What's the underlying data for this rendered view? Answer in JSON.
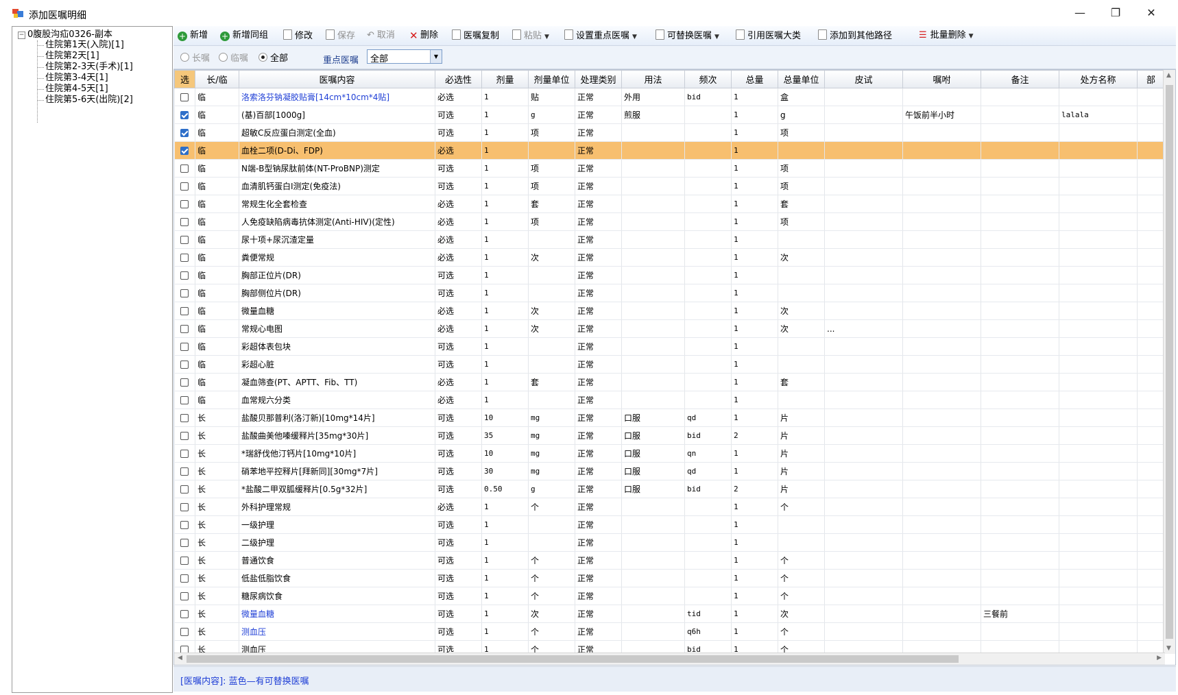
{
  "window": {
    "title": "添加医嘱明细",
    "minimize_icon": "minimize-icon",
    "maximize_icon": "maximize-icon",
    "close_icon": "close-icon"
  },
  "tree": {
    "root": "0腹股沟疝0326-副本",
    "items": [
      "住院第1天(入院)[1]",
      "住院第2天[1]",
      "住院第2-3天(手术)[1]",
      "住院第3-4天[1]",
      "住院第4-5天[1]",
      "住院第5-6天(出院)[2]"
    ]
  },
  "toolbar": {
    "add": "新增",
    "add_group": "新增同组",
    "edit": "修改",
    "save": "保存",
    "cancel": "取消",
    "delete": "删除",
    "copy": "医嘱复制",
    "paste": "粘贴",
    "set_focus": "设置重点医嘱",
    "replaceable": "可替换医嘱",
    "reference": "引用医嘱大类",
    "add_other": "添加到其他路径",
    "batch_delete": "批量删除"
  },
  "filter": {
    "long_term": "长嘱",
    "temporary": "临嘱",
    "all": "全部",
    "selected": "全部",
    "focus_label": "重点医嘱",
    "focus_value": "全部"
  },
  "grid": {
    "columns": [
      "选",
      "长/临",
      "医嘱内容",
      "必选性",
      "剂量",
      "剂量单位",
      "处理类别",
      "用法",
      "频次",
      "总量",
      "总量单位",
      "皮试",
      "嘱咐",
      "备注",
      "处方名称",
      "部"
    ],
    "rows": [
      {
        "checked": false,
        "type": "临",
        "content": "洛索洛芬钠凝胶贴膏[14cm*10cm*4贴]",
        "required": "必选",
        "dose": "1",
        "dose_unit": "贴",
        "category": "正常",
        "usage": "外用",
        "freq": "bid",
        "total": "1",
        "total_unit": "盒",
        "skin_test": "",
        "instruction": "",
        "remark": "",
        "rx_name": "",
        "blue": true,
        "highlight": false
      },
      {
        "checked": true,
        "type": "临",
        "content": "(基)百部[1000g]",
        "required": "可选",
        "dose": "1",
        "dose_unit": "g",
        "category": "正常",
        "usage": "煎服",
        "freq": "",
        "total": "1",
        "total_unit": "g",
        "skin_test": "",
        "instruction": "午饭前半小时",
        "remark": "",
        "rx_name": "lalala",
        "blue": false,
        "highlight": false
      },
      {
        "checked": true,
        "type": "临",
        "content": "超敏C反应蛋白测定(全血)",
        "required": "可选",
        "dose": "1",
        "dose_unit": "项",
        "category": "正常",
        "usage": "",
        "freq": "",
        "total": "1",
        "total_unit": "项",
        "skin_test": "",
        "instruction": "",
        "remark": "",
        "rx_name": "",
        "blue": false,
        "highlight": false
      },
      {
        "checked": true,
        "type": "临",
        "content": "血栓二项(D-Di、FDP)",
        "required": "必选",
        "dose": "1",
        "dose_unit": "",
        "category": "正常",
        "usage": "",
        "freq": "",
        "total": "1",
        "total_unit": "",
        "skin_test": "",
        "instruction": "",
        "remark": "",
        "rx_name": "",
        "blue": false,
        "highlight": true
      },
      {
        "checked": false,
        "type": "临",
        "content": "N端-B型钠尿肽前体(NT-ProBNP)测定",
        "required": "可选",
        "dose": "1",
        "dose_unit": "项",
        "category": "正常",
        "usage": "",
        "freq": "",
        "total": "1",
        "total_unit": "项",
        "skin_test": "",
        "instruction": "",
        "remark": "",
        "rx_name": "",
        "blue": false,
        "highlight": false
      },
      {
        "checked": false,
        "type": "临",
        "content": "血清肌钙蛋白Ⅰ测定(免疫法)",
        "required": "可选",
        "dose": "1",
        "dose_unit": "项",
        "category": "正常",
        "usage": "",
        "freq": "",
        "total": "1",
        "total_unit": "项",
        "skin_test": "",
        "instruction": "",
        "remark": "",
        "rx_name": "",
        "blue": false,
        "highlight": false
      },
      {
        "checked": false,
        "type": "临",
        "content": "常规生化全套检查",
        "required": "必选",
        "dose": "1",
        "dose_unit": "套",
        "category": "正常",
        "usage": "",
        "freq": "",
        "total": "1",
        "total_unit": "套",
        "skin_test": "",
        "instruction": "",
        "remark": "",
        "rx_name": "",
        "blue": false,
        "highlight": false
      },
      {
        "checked": false,
        "type": "临",
        "content": "人免疫缺陷病毒抗体测定(Anti-HIV)(定性)",
        "required": "必选",
        "dose": "1",
        "dose_unit": "项",
        "category": "正常",
        "usage": "",
        "freq": "",
        "total": "1",
        "total_unit": "项",
        "skin_test": "",
        "instruction": "",
        "remark": "",
        "rx_name": "",
        "blue": false,
        "highlight": false
      },
      {
        "checked": false,
        "type": "临",
        "content": "尿十项+尿沉渣定量",
        "required": "必选",
        "dose": "1",
        "dose_unit": "",
        "category": "正常",
        "usage": "",
        "freq": "",
        "total": "1",
        "total_unit": "",
        "skin_test": "",
        "instruction": "",
        "remark": "",
        "rx_name": "",
        "blue": false,
        "highlight": false
      },
      {
        "checked": false,
        "type": "临",
        "content": "粪便常规",
        "required": "必选",
        "dose": "1",
        "dose_unit": "次",
        "category": "正常",
        "usage": "",
        "freq": "",
        "total": "1",
        "total_unit": "次",
        "skin_test": "",
        "instruction": "",
        "remark": "",
        "rx_name": "",
        "blue": false,
        "highlight": false
      },
      {
        "checked": false,
        "type": "临",
        "content": "胸部正位片(DR)",
        "required": "可选",
        "dose": "1",
        "dose_unit": "",
        "category": "正常",
        "usage": "",
        "freq": "",
        "total": "1",
        "total_unit": "",
        "skin_test": "",
        "instruction": "",
        "remark": "",
        "rx_name": "",
        "blue": false,
        "highlight": false
      },
      {
        "checked": false,
        "type": "临",
        "content": "胸部侧位片(DR)",
        "required": "可选",
        "dose": "1",
        "dose_unit": "",
        "category": "正常",
        "usage": "",
        "freq": "",
        "total": "1",
        "total_unit": "",
        "skin_test": "",
        "instruction": "",
        "remark": "",
        "rx_name": "",
        "blue": false,
        "highlight": false
      },
      {
        "checked": false,
        "type": "临",
        "content": "微量血糖",
        "required": "必选",
        "dose": "1",
        "dose_unit": "次",
        "category": "正常",
        "usage": "",
        "freq": "",
        "total": "1",
        "total_unit": "次",
        "skin_test": "",
        "instruction": "",
        "remark": "",
        "rx_name": "",
        "blue": false,
        "highlight": false
      },
      {
        "checked": false,
        "type": "临",
        "content": "常规心电图",
        "required": "必选",
        "dose": "1",
        "dose_unit": "次",
        "category": "正常",
        "usage": "",
        "freq": "",
        "total": "1",
        "total_unit": "次",
        "skin_test": "...",
        "instruction": "",
        "remark": "",
        "rx_name": "",
        "blue": false,
        "highlight": false
      },
      {
        "checked": false,
        "type": "临",
        "content": "彩超体表包块",
        "required": "可选",
        "dose": "1",
        "dose_unit": "",
        "category": "正常",
        "usage": "",
        "freq": "",
        "total": "1",
        "total_unit": "",
        "skin_test": "",
        "instruction": "",
        "remark": "",
        "rx_name": "",
        "blue": false,
        "highlight": false
      },
      {
        "checked": false,
        "type": "临",
        "content": "彩超心脏",
        "required": "可选",
        "dose": "1",
        "dose_unit": "",
        "category": "正常",
        "usage": "",
        "freq": "",
        "total": "1",
        "total_unit": "",
        "skin_test": "",
        "instruction": "",
        "remark": "",
        "rx_name": "",
        "blue": false,
        "highlight": false
      },
      {
        "checked": false,
        "type": "临",
        "content": "凝血筛查(PT、APTT、Fib、TT)",
        "required": "必选",
        "dose": "1",
        "dose_unit": "套",
        "category": "正常",
        "usage": "",
        "freq": "",
        "total": "1",
        "total_unit": "套",
        "skin_test": "",
        "instruction": "",
        "remark": "",
        "rx_name": "",
        "blue": false,
        "highlight": false
      },
      {
        "checked": false,
        "type": "临",
        "content": "血常规六分类",
        "required": "必选",
        "dose": "1",
        "dose_unit": "",
        "category": "正常",
        "usage": "",
        "freq": "",
        "total": "1",
        "total_unit": "",
        "skin_test": "",
        "instruction": "",
        "remark": "",
        "rx_name": "",
        "blue": false,
        "highlight": false
      },
      {
        "checked": false,
        "type": "长",
        "content": "盐酸贝那普利(洛汀新)[10mg*14片]",
        "required": "可选",
        "dose": "10",
        "dose_unit": "mg",
        "category": "正常",
        "usage": "口服",
        "freq": "qd",
        "total": "1",
        "total_unit": "片",
        "skin_test": "",
        "instruction": "",
        "remark": "",
        "rx_name": "",
        "blue": false,
        "highlight": false
      },
      {
        "checked": false,
        "type": "长",
        "content": "盐酸曲美他嗪缓释片[35mg*30片]",
        "required": "可选",
        "dose": "35",
        "dose_unit": "mg",
        "category": "正常",
        "usage": "口服",
        "freq": "bid",
        "total": "2",
        "total_unit": "片",
        "skin_test": "",
        "instruction": "",
        "remark": "",
        "rx_name": "",
        "blue": false,
        "highlight": false
      },
      {
        "checked": false,
        "type": "长",
        "content": "*瑞舒伐他汀钙片[10mg*10片]",
        "required": "可选",
        "dose": "10",
        "dose_unit": "mg",
        "category": "正常",
        "usage": "口服",
        "freq": "qn",
        "total": "1",
        "total_unit": "片",
        "skin_test": "",
        "instruction": "",
        "remark": "",
        "rx_name": "",
        "blue": false,
        "highlight": false
      },
      {
        "checked": false,
        "type": "长",
        "content": "硝苯地平控释片[拜新同][30mg*7片]",
        "required": "可选",
        "dose": "30",
        "dose_unit": "mg",
        "category": "正常",
        "usage": "口服",
        "freq": "qd",
        "total": "1",
        "total_unit": "片",
        "skin_test": "",
        "instruction": "",
        "remark": "",
        "rx_name": "",
        "blue": false,
        "highlight": false
      },
      {
        "checked": false,
        "type": "长",
        "content": "*盐酸二甲双胍缓释片[0.5g*32片]",
        "required": "可选",
        "dose": "0.50",
        "dose_unit": "g",
        "category": "正常",
        "usage": "口服",
        "freq": "bid",
        "total": "2",
        "total_unit": "片",
        "skin_test": "",
        "instruction": "",
        "remark": "",
        "rx_name": "",
        "blue": false,
        "highlight": false
      },
      {
        "checked": false,
        "type": "长",
        "content": "外科护理常规",
        "required": "必选",
        "dose": "1",
        "dose_unit": "个",
        "category": "正常",
        "usage": "",
        "freq": "",
        "total": "1",
        "total_unit": "个",
        "skin_test": "",
        "instruction": "",
        "remark": "",
        "rx_name": "",
        "blue": false,
        "highlight": false
      },
      {
        "checked": false,
        "type": "长",
        "content": "一级护理",
        "required": "可选",
        "dose": "1",
        "dose_unit": "",
        "category": "正常",
        "usage": "",
        "freq": "",
        "total": "1",
        "total_unit": "",
        "skin_test": "",
        "instruction": "",
        "remark": "",
        "rx_name": "",
        "blue": false,
        "highlight": false
      },
      {
        "checked": false,
        "type": "长",
        "content": "二级护理",
        "required": "可选",
        "dose": "1",
        "dose_unit": "",
        "category": "正常",
        "usage": "",
        "freq": "",
        "total": "1",
        "total_unit": "",
        "skin_test": "",
        "instruction": "",
        "remark": "",
        "rx_name": "",
        "blue": false,
        "highlight": false
      },
      {
        "checked": false,
        "type": "长",
        "content": "普通饮食",
        "required": "可选",
        "dose": "1",
        "dose_unit": "个",
        "category": "正常",
        "usage": "",
        "freq": "",
        "total": "1",
        "total_unit": "个",
        "skin_test": "",
        "instruction": "",
        "remark": "",
        "rx_name": "",
        "blue": false,
        "highlight": false
      },
      {
        "checked": false,
        "type": "长",
        "content": "低盐低脂饮食",
        "required": "可选",
        "dose": "1",
        "dose_unit": "个",
        "category": "正常",
        "usage": "",
        "freq": "",
        "total": "1",
        "total_unit": "个",
        "skin_test": "",
        "instruction": "",
        "remark": "",
        "rx_name": "",
        "blue": false,
        "highlight": false
      },
      {
        "checked": false,
        "type": "长",
        "content": "糖尿病饮食",
        "required": "可选",
        "dose": "1",
        "dose_unit": "个",
        "category": "正常",
        "usage": "",
        "freq": "",
        "total": "1",
        "total_unit": "个",
        "skin_test": "",
        "instruction": "",
        "remark": "",
        "rx_name": "",
        "blue": false,
        "highlight": false
      },
      {
        "checked": false,
        "type": "长",
        "content": "微量血糖",
        "required": "可选",
        "dose": "1",
        "dose_unit": "次",
        "category": "正常",
        "usage": "",
        "freq": "tid",
        "total": "1",
        "total_unit": "次",
        "skin_test": "",
        "instruction": "",
        "remark": "三餐前",
        "rx_name": "",
        "blue": true,
        "highlight": false
      },
      {
        "checked": false,
        "type": "长",
        "content": "测血压",
        "required": "可选",
        "dose": "1",
        "dose_unit": "个",
        "category": "正常",
        "usage": "",
        "freq": "q6h",
        "total": "1",
        "total_unit": "个",
        "skin_test": "",
        "instruction": "",
        "remark": "",
        "rx_name": "",
        "blue": true,
        "highlight": false
      },
      {
        "checked": false,
        "type": "长",
        "content": "测血压",
        "required": "可选",
        "dose": "1",
        "dose_unit": "个",
        "category": "正常",
        "usage": "",
        "freq": "bid",
        "total": "1",
        "total_unit": "个",
        "skin_test": "",
        "instruction": "",
        "remark": "",
        "rx_name": "",
        "blue": false,
        "highlight": false
      }
    ]
  },
  "status": {
    "legend": "[医嘱内容]: 蓝色—有可替换医嘱"
  },
  "colors": {
    "highlight_row": "#f7bf6f",
    "replaceable_text": "#1f3fd6",
    "checkbox_checked": "#2e6fc9",
    "toolbar_add": "#2e9a3a",
    "delete_x": "#d61c1c"
  }
}
